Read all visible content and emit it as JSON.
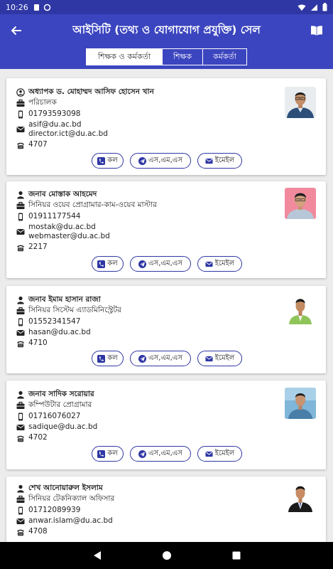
{
  "status_bar": {
    "time": "10:26"
  },
  "app_bar": {
    "title": "আইসিটি (তথ্য ও যোগাযোগ প্রযুক্তি) সেল"
  },
  "tabs": [
    {
      "label": "শিক্ষক ও কর্মকর্তা",
      "active": true
    },
    {
      "label": "শিক্ষক",
      "active": false
    },
    {
      "label": "কর্মকর্তা",
      "active": false
    }
  ],
  "buttons": {
    "call": "কল",
    "sms": "এস,এম,এস",
    "email": "ইমেইল"
  },
  "contacts": [
    {
      "name": "অধ্যাপক ড. মোহাম্মদ আসিফ হোসেন খান",
      "designation": "পরিচালক",
      "phone": "01793593098",
      "emails": [
        "asif@du.ac.bd",
        "director.ict@du.ac.bd"
      ],
      "ext": "4707"
    },
    {
      "name": "জনাব মোস্তাক আহমেদ",
      "designation": "সিনিয়র ওয়েব প্রোগ্রামার-কাম-ওয়েব মাস্টার",
      "phone": "01911177544",
      "emails": [
        "mostak@du.ac.bd",
        "webmaster@du.ac.bd"
      ],
      "ext": "2217"
    },
    {
      "name": "জনাব ইমাম হাসান রাজা",
      "designation": "সিনিয়র সিস্টেম এ্যাডমিনিস্ট্রেটর",
      "phone": "01552341547",
      "emails": [
        "hasan@du.ac.bd"
      ],
      "ext": "4710"
    },
    {
      "name": "জনাব সাদিক সরোয়ার",
      "designation": "কম্পিউটার প্রোগ্রামার",
      "phone": "01716076027",
      "emails": [
        "sadique@du.ac.bd"
      ],
      "ext": "4702"
    },
    {
      "name": "শেখ আনোয়ারুল ইসলাম",
      "designation": "সিনিয়র টেকনিক্যাল অফিসার",
      "phone": "01712089939",
      "emails": [
        "anwar.islam@du.ac.bd"
      ],
      "ext": "4708"
    }
  ],
  "colors": {
    "primary": "#3b45bf",
    "status_bar": "#2f37a4",
    "background": "#ececec",
    "button_border": "#2f37a4"
  }
}
